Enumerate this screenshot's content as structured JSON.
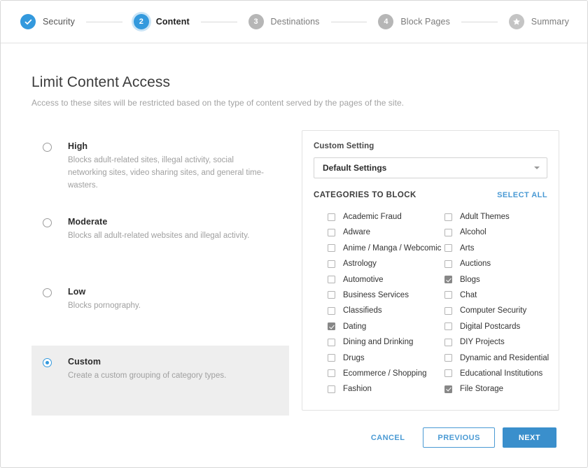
{
  "wizard": {
    "steps": [
      {
        "id": "security",
        "label": "Security",
        "marker": "check",
        "state": "done"
      },
      {
        "id": "content",
        "label": "Content",
        "marker": "2",
        "state": "current"
      },
      {
        "id": "destinations",
        "label": "Destinations",
        "marker": "3",
        "state": "todo"
      },
      {
        "id": "block-pages",
        "label": "Block Pages",
        "marker": "4",
        "state": "todo"
      },
      {
        "id": "summary",
        "label": "Summary",
        "marker": "star",
        "state": "todo"
      }
    ]
  },
  "header": {
    "title": "Limit Content Access",
    "subtitle": "Access to these sites will be restricted based on the type of content served by the pages of the site."
  },
  "levels": [
    {
      "id": "high",
      "name": "High",
      "description": "Blocks adult-related sites, illegal activity, social networking sites, video sharing sites, and general time-wasters.",
      "selected": false
    },
    {
      "id": "moderate",
      "name": "Moderate",
      "description": "Blocks all adult-related websites and illegal activity.",
      "selected": false
    },
    {
      "id": "low",
      "name": "Low",
      "description": "Blocks pornography.",
      "selected": false
    },
    {
      "id": "custom",
      "name": "Custom",
      "description": "Create a custom grouping of category types.",
      "selected": true
    }
  ],
  "custom_panel": {
    "setting_label": "Custom Setting",
    "setting_value": "Default Settings",
    "categories_title": "CATEGORIES TO BLOCK",
    "select_all_label": "SELECT ALL",
    "columns": [
      [
        {
          "label": "Academic Fraud",
          "checked": false
        },
        {
          "label": "Adware",
          "checked": false
        },
        {
          "label": "Anime / Manga / Webcomic",
          "checked": false
        },
        {
          "label": "Astrology",
          "checked": false
        },
        {
          "label": "Automotive",
          "checked": false
        },
        {
          "label": "Business Services",
          "checked": false
        },
        {
          "label": "Classifieds",
          "checked": false
        },
        {
          "label": "Dating",
          "checked": true
        },
        {
          "label": "Dining and Drinking",
          "checked": false
        },
        {
          "label": "Drugs",
          "checked": false
        },
        {
          "label": "Ecommerce / Shopping",
          "checked": false
        },
        {
          "label": "Fashion",
          "checked": false
        }
      ],
      [
        {
          "label": "Adult Themes",
          "checked": false
        },
        {
          "label": "Alcohol",
          "checked": false
        },
        {
          "label": "Arts",
          "checked": false
        },
        {
          "label": "Auctions",
          "checked": false
        },
        {
          "label": "Blogs",
          "checked": true
        },
        {
          "label": "Chat",
          "checked": false
        },
        {
          "label": "Computer Security",
          "checked": false
        },
        {
          "label": "Digital Postcards",
          "checked": false
        },
        {
          "label": "DIY Projects",
          "checked": false
        },
        {
          "label": "Dynamic and Residential",
          "checked": false
        },
        {
          "label": "Educational Institutions",
          "checked": false
        },
        {
          "label": "File Storage",
          "checked": true
        }
      ]
    ]
  },
  "footer": {
    "cancel_label": "CANCEL",
    "previous_label": "PREVIOUS",
    "next_label": "NEXT"
  },
  "colors": {
    "accent_blue": "#3399dd",
    "link_blue": "#4a9ad4",
    "next_button": "#3a8fcc",
    "selected_row": "#eeeeee",
    "inactive_step": "#b6b6b6"
  }
}
